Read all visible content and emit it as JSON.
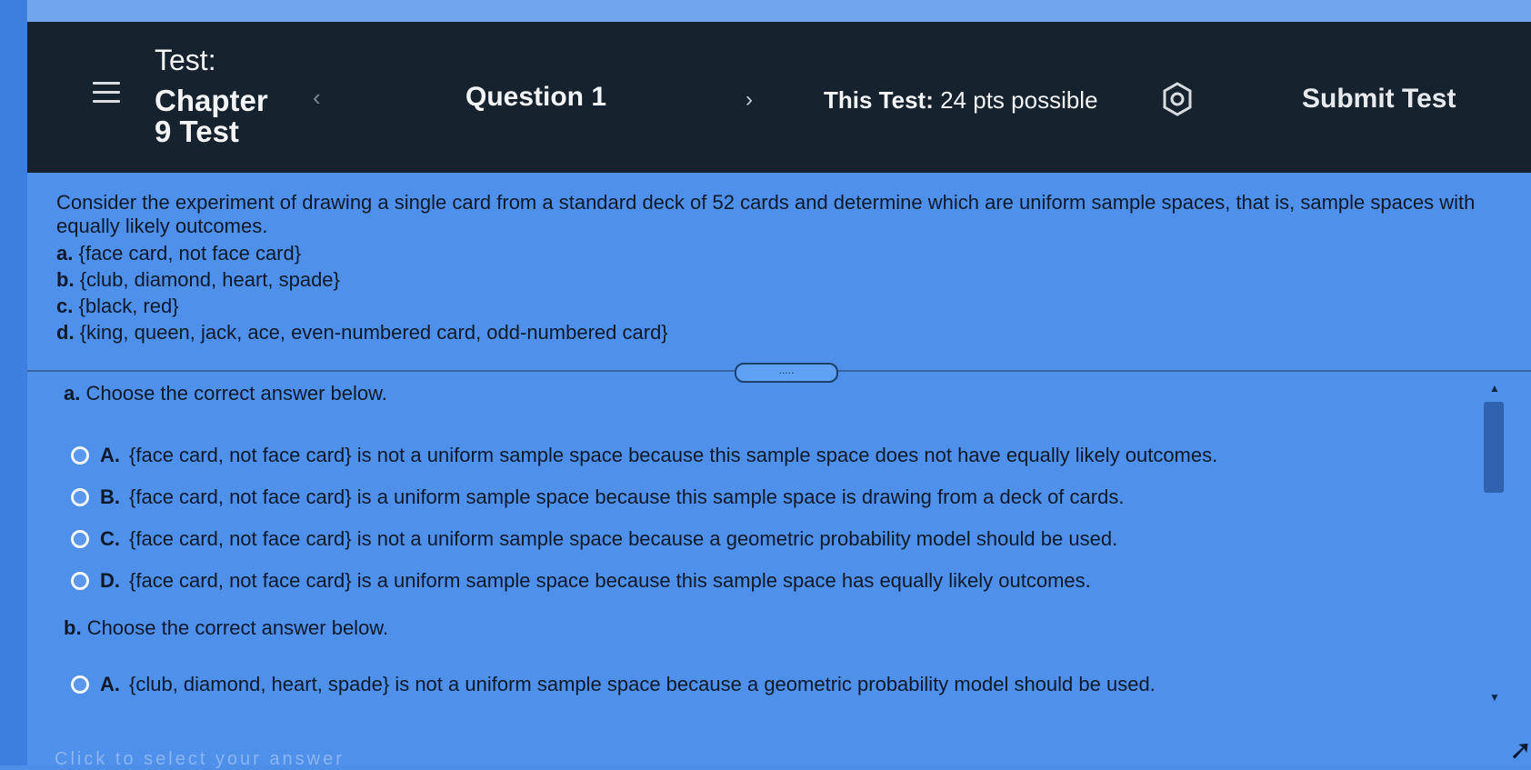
{
  "header": {
    "menu_icon": "hamburger-menu-icon",
    "test_label": "Test:",
    "test_title": "Chapter 9 Test",
    "prev_icon_glyph": "‹",
    "question_label": "Question 1",
    "next_icon_glyph": "›",
    "points_prefix": "This Test:",
    "points_value": "24 pts possible",
    "settings_icon": "gear-icon",
    "submit_label": "Submit Test"
  },
  "question": {
    "text": "Consider the experiment of drawing a single card from a standard deck of 52 cards and determine which are uniform sample spaces, that is, sample spaces with equally likely outcomes.",
    "items": [
      {
        "letter": "a.",
        "text": "{face card, not face card}"
      },
      {
        "letter": "b.",
        "text": "{club, diamond, heart, spade}"
      },
      {
        "letter": "c.",
        "text": "{black, red}"
      },
      {
        "letter": "d.",
        "text": "{king, queen, jack, ace, even-numbered card, odd-numbered card}"
      }
    ]
  },
  "divider": {
    "handle_label": "....."
  },
  "parts": [
    {
      "letter": "a.",
      "prompt": "Choose the correct answer below.",
      "options": [
        {
          "letter": "A.",
          "text": "{face card, not face card} is not a uniform sample space because this sample space does not have equally likely outcomes."
        },
        {
          "letter": "B.",
          "text": "{face card, not face card} is a uniform sample space because this sample space is drawing from a deck of cards."
        },
        {
          "letter": "C.",
          "text": "{face card, not face card} is not a uniform sample space because a geometric probability model should be used."
        },
        {
          "letter": "D.",
          "text": "{face card, not face card} is a uniform sample space because this sample space has equally likely outcomes."
        }
      ]
    },
    {
      "letter": "b.",
      "prompt": "Choose the correct answer below.",
      "options": [
        {
          "letter": "A.",
          "text": "{club, diamond, heart, spade} is not a uniform sample space because a geometric probability model should be used."
        }
      ]
    }
  ],
  "scrollbar": {
    "up_glyph": "▲",
    "down_glyph": "▼"
  },
  "footer": {
    "hint": "Click to select your answer"
  },
  "colors": {
    "header_bg": "#16222d",
    "content_bg": "#4e90ea",
    "accent": "#2f63b0"
  }
}
